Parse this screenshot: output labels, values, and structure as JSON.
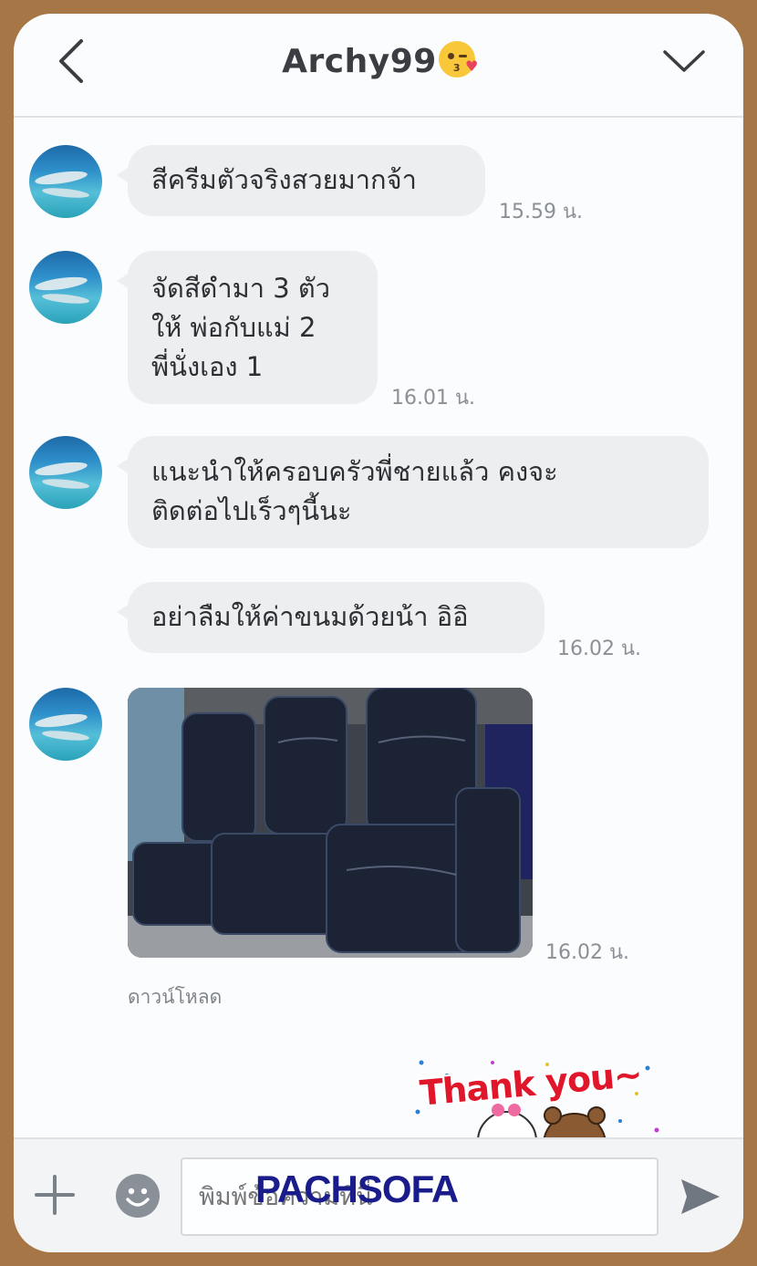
{
  "header": {
    "title": "Archy99",
    "back_icon": "chevron-left-icon",
    "menu_icon": "chevron-down-icon",
    "emoji_icon": "kissing-face-with-heart-icon"
  },
  "messages": [
    {
      "text": "สีครีมตัวจริงสวยมากจ้า",
      "time": "15.59 น."
    },
    {
      "lines": [
        "จัดสีดำมา 3 ตัว",
        "ให้ พ่อกับแม่ 2",
        "พี่นั่งเอง 1"
      ],
      "time": "16.01 น."
    },
    {
      "lines": [
        "แนะนำให้ครอบครัวพี่ชายแล้ว คงจะ",
        "ติดต่อไปเร็วๆนี้นะ"
      ]
    },
    {
      "text": "อย่าลืมให้ค่าขนมด้วยน้า อิอิ",
      "time": "16.02 น."
    },
    {
      "type": "image",
      "time": "16.02 น.",
      "download_label": "ดาวน์โหลด"
    }
  ],
  "sticker": {
    "text": "Thank you~"
  },
  "input": {
    "placeholder": "พิมพ์ข้อความที่นี่"
  },
  "watermark": "PACHSOFA",
  "colors": {
    "frame": "#a67646",
    "bubble": "#eceeef",
    "sticker_text": "#e0162b",
    "watermark": "#1b1c8c"
  }
}
